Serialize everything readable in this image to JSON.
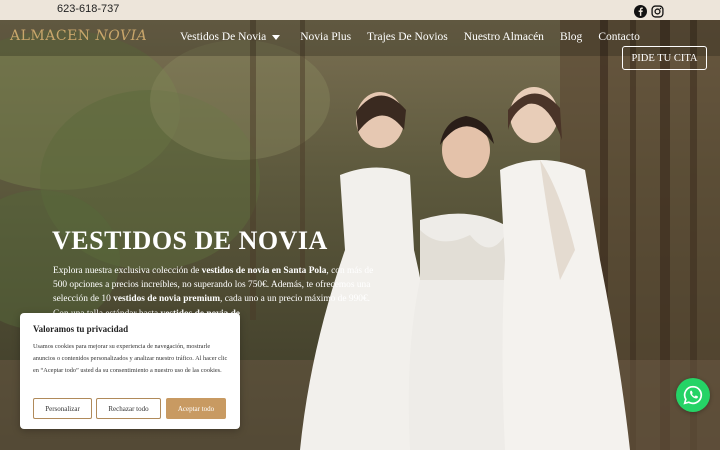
{
  "topbar": {
    "phone": "623-618-737",
    "social_icons": [
      "facebook-icon",
      "instagram-icon"
    ]
  },
  "nav": {
    "logo_part1": "ALMACEN",
    "logo_part2": "NOVIA",
    "items": [
      {
        "label": "Vestidos De Novia",
        "has_dropdown": true
      },
      {
        "label": "Novia Plus"
      },
      {
        "label": "Trajes De Novios"
      },
      {
        "label": "Nuestro Almacén"
      },
      {
        "label": "Blog"
      },
      {
        "label": "Contacto"
      }
    ],
    "cta": "PIDE TU CITA"
  },
  "hero": {
    "title": "VESTIDOS DE NOVIA",
    "intro": [
      {
        "t": "Explora nuestra exclusiva colección de ",
        "b": false
      },
      {
        "t": "vestidos de novia en Santa Pola",
        "b": true
      },
      {
        "t": ", con más de 500 opciones a precios increíbles, no superando los 750€. Además, te ofrecemos una selección de 10 ",
        "b": false
      },
      {
        "t": "vestidos de novia premium",
        "b": true
      },
      {
        "t": ", cada uno a un precio máximo de 990€. Con una talla estándar hasta ",
        "b": false
      },
      {
        "t": "vestidos de novia de",
        "b": true
      }
    ]
  },
  "cookie": {
    "title": "Valoramos tu privacidad",
    "text": "Usamos cookies para mejorar su experiencia de navegación, mostrarle anuncios o contenidos personalizados y analizar nuestro tráfico. Al hacer clic en “Aceptar todo” usted da su consentimiento a nuestro uso de las cookies.",
    "customize": "Personalizar",
    "reject": "Rechazar todo",
    "accept": "Aceptar todo"
  },
  "colors": {
    "accent": "#c89a62",
    "topbar": "#ede5da",
    "whatsapp": "#25d366"
  },
  "float": {
    "icon": "whatsapp-icon"
  }
}
